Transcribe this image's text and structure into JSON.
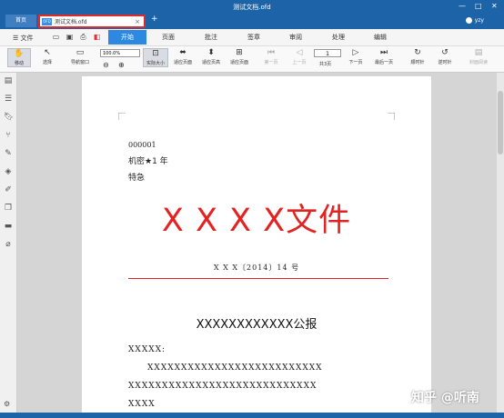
{
  "window": {
    "title": "测试文档.ofd"
  },
  "tabs": {
    "home": "首页",
    "doc_icon": "OFD",
    "document": "测试文档.ofd",
    "close": "×",
    "add": "+"
  },
  "window_controls": {
    "minimize": "—",
    "maximize": "□",
    "close": "✕"
  },
  "user": {
    "name": "yzy"
  },
  "menu": {
    "file": "☰ 文件",
    "tabs": [
      "开始",
      "页面",
      "批注",
      "签章",
      "审阅",
      "处理",
      "编辑"
    ],
    "active_tab": "开始"
  },
  "toolbar": {
    "move": "移动",
    "select": "选择",
    "nav_window": "导航窗口",
    "zoom_value": "100.0%",
    "actual_size": "实际大小",
    "fit_page": "适应页面",
    "fit_height": "适应页高",
    "fit_width": "适应页面",
    "first_page": "第一页",
    "prev_page": "上一页",
    "page_value": "1",
    "total_pages": "共3页",
    "next_page": "下一页",
    "last_page": "最后一页",
    "rotate_cw": "顺时针",
    "rotate_ccw": "逆时针",
    "close_reading": "封面阅读"
  },
  "document": {
    "number": "000001",
    "secrecy": "机密★1 年",
    "urgency": "特急",
    "title": "X X X X文件",
    "serial": "X X X〔2014〕14 号",
    "heading": "XXXXXXXXXXXX公报",
    "greeting": "XXXXX:",
    "body_lines": [
      "XXXXXXXXXXXXXXXXXXXXXXXXXX",
      "XXXXXXXXXXXXXXXXXXXXXXXXXXXX",
      "XXXX"
    ]
  },
  "watermark": "知乎 @听南",
  "colors": {
    "titlebar": "#1d63a8",
    "accent": "#2c88e0",
    "doc_red": "#e32222",
    "tab_highlight": "#e02a2a"
  }
}
